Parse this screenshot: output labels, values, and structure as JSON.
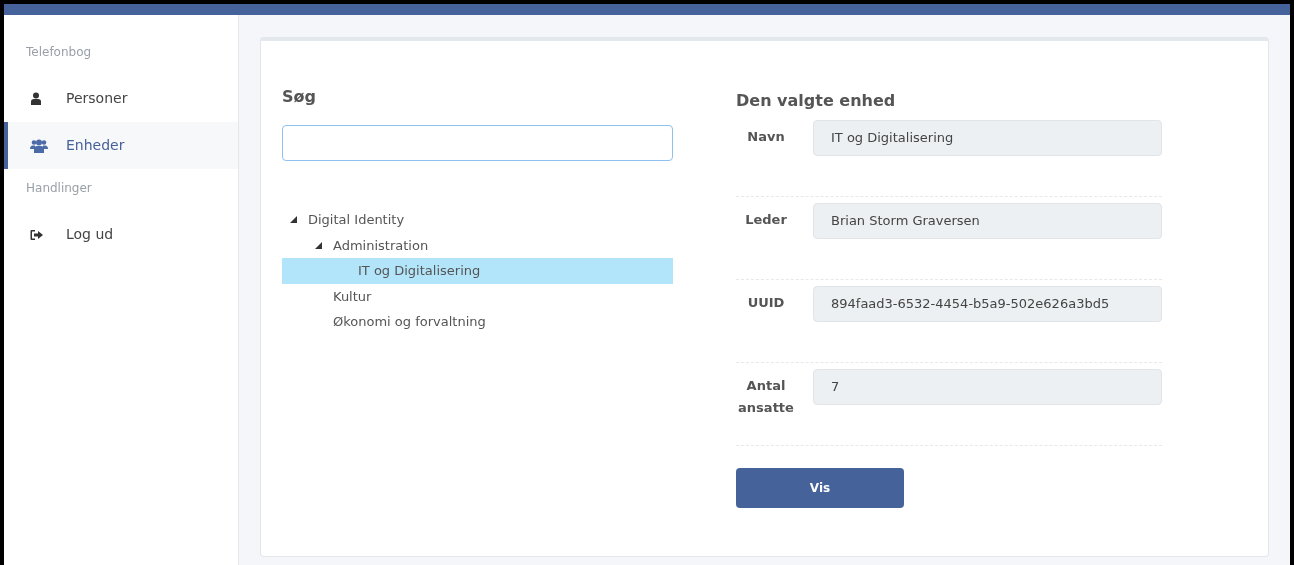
{
  "sidebar": {
    "sections": [
      {
        "heading": "Telefonbog",
        "items": [
          {
            "label": "Personer",
            "kind": "person",
            "selected": false
          },
          {
            "label": "Enheder",
            "kind": "group",
            "selected": true
          }
        ]
      },
      {
        "heading": "Handlinger",
        "items": [
          {
            "label": "Log ud",
            "kind": "logout",
            "selected": false
          }
        ]
      }
    ]
  },
  "search": {
    "heading": "Søg"
  },
  "tree": [
    {
      "label": "Digital Identity",
      "expanded": true,
      "selected": false,
      "children": [
        {
          "label": "Administration",
          "expanded": true,
          "selected": false,
          "children": [
            {
              "label": "IT og Digitalisering",
              "selected": true
            }
          ]
        },
        {
          "label": "Kultur",
          "selected": false
        },
        {
          "label": "Økonomi og forvaltning",
          "selected": false
        }
      ]
    }
  ],
  "details": {
    "heading": "Den valgte enhed",
    "fields": [
      {
        "label": "Navn",
        "value": "IT og Digitalisering"
      },
      {
        "label": "Leder",
        "value": "Brian Storm Graversen"
      },
      {
        "label": "UUID",
        "value": "894faad3-6532-4454-b5a9-502e626a3bd5"
      },
      {
        "label": "Antal ansatte",
        "value": "7"
      }
    ],
    "button": "Vis"
  }
}
